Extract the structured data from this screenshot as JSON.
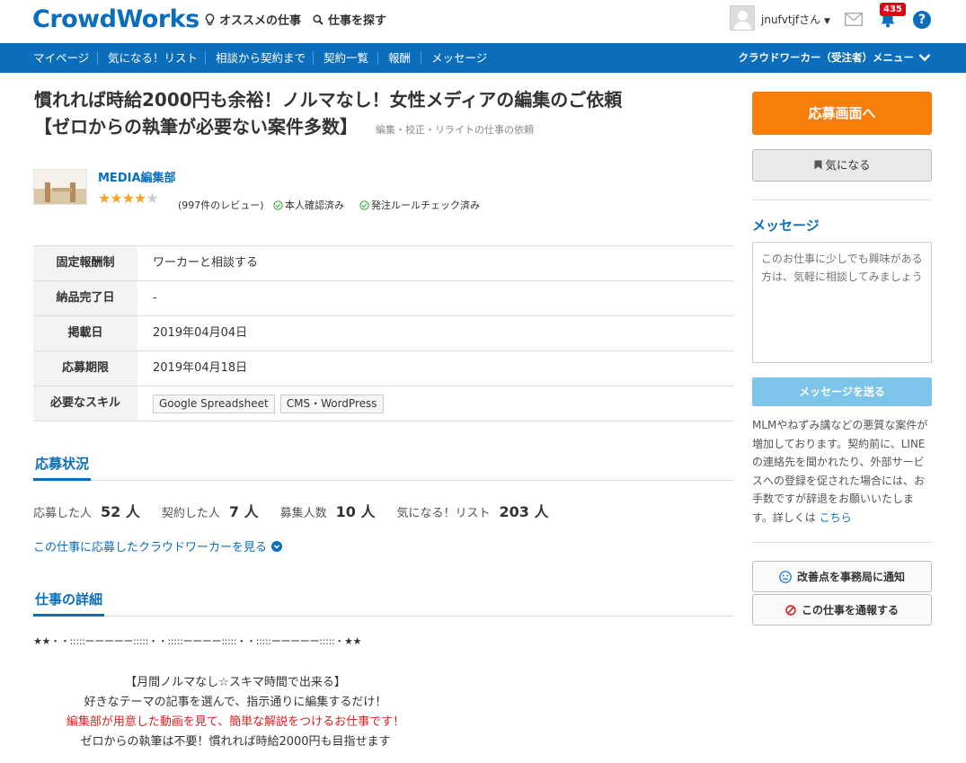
{
  "header": {
    "logo": "CrowdWorks",
    "links": [
      "オススメの仕事",
      "仕事を探す"
    ],
    "username": "jnufvtjfさん",
    "notification_count": "435",
    "help_label": "?"
  },
  "nav": {
    "items": [
      "マイページ",
      "気になる！リスト",
      "相談から契約まで",
      "契約一覧",
      "報酬",
      "メッセージ"
    ],
    "right_menu": "クラウドワーカー（受注者）メニュー"
  },
  "job": {
    "title_line1": "慣れれば時給2000円も余裕！ノルマなし！女性メディアの編集のご依頼",
    "title_line2": "【ゼロからの執筆が必要ない案件多数】",
    "category": "編集・校正・リライトの仕事の依頼"
  },
  "client": {
    "name": "MEDIA編集部",
    "stars_filled": "★★★★",
    "stars_half": "★",
    "rating": 4.5,
    "reviews": "(997件のレビュー)",
    "verify1": "本人確認済み",
    "verify2": "発注ルールチェック済み"
  },
  "info": {
    "rows": [
      {
        "label": "固定報酬制",
        "value": "ワーカーと相談する"
      },
      {
        "label": "納品完了日",
        "value": "-"
      },
      {
        "label": "掲載日",
        "value": "2019年04月04日"
      },
      {
        "label": "応募期限",
        "value": "2019年04月18日"
      }
    ],
    "skills_label": "必要なスキル",
    "skills": [
      "Google Spreadsheet",
      "CMS・WordPress"
    ]
  },
  "status": {
    "heading": "応募状況",
    "applied_label": "応募した人",
    "applied": "52 人",
    "contracted_label": "契約した人",
    "contracted": "7 人",
    "recruit_label": "募集人数",
    "recruit": "10 人",
    "fav_label": "気になる！リスト",
    "fav": "203 人",
    "applicants_link": "この仕事に応募したクラウドワーカーを見る"
  },
  "details": {
    "heading": "仕事の詳細",
    "divider": "★★・・:::::ーーーーー:::::・・:::::ーーーー:::::・・:::::ーーーーー:::::・★★",
    "line1": "【月間ノルマなし☆スキマ時間で出来る】",
    "line2": "好きなテーマの記事を選んで、指示通りに編集するだけ！",
    "line3": "編集部が用意した動画を見て、簡単な解説をつけるお仕事です！",
    "line4": "ゼロからの執筆は不要！慣れれば時給2000円も目指せます"
  },
  "sidebar": {
    "apply": "応募画面へ",
    "favorite": "気になる",
    "message_heading": "メッセージ",
    "message_placeholder": "このお仕事に少しでも興味がある方は、気軽に相談してみましょう",
    "send": "メッセージを送る",
    "warning": "MLMやねずみ講などの悪質な案件が増加しております。契約前に、LINEの連絡先を聞かれたり、外部サービスへの登録を促された場合には、お手数ですが辞退をお願いいたします。詳しくは",
    "warning_link": "こちら",
    "improve": "改善点を事務局に通知",
    "report": "この仕事を通報する"
  },
  "colors": {
    "brand": "#0a6ebd",
    "apply": "#f87e0c",
    "badge": "#e60012"
  }
}
